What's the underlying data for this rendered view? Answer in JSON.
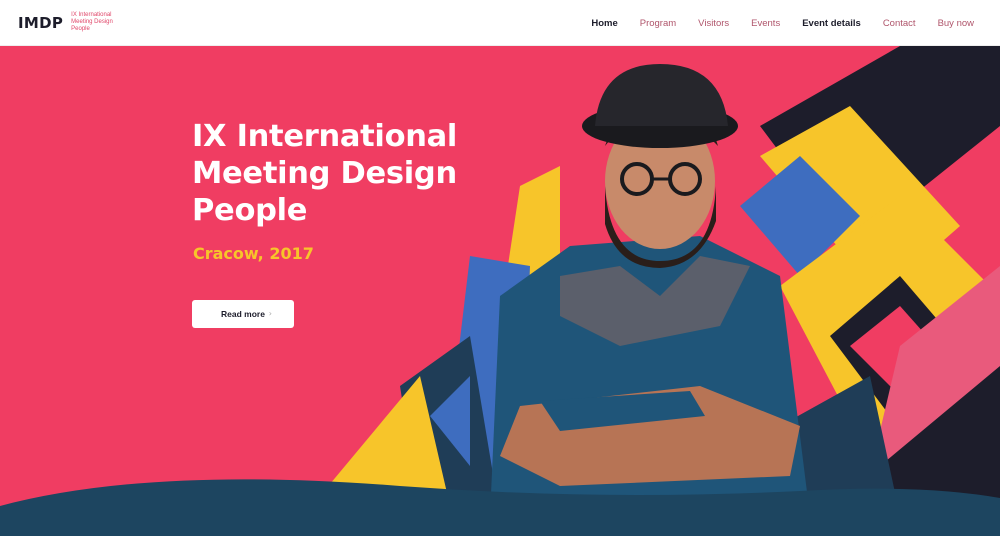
{
  "brand": {
    "logo": "IMDP",
    "tagline": "IX International Meeting Design People"
  },
  "nav": {
    "items": [
      {
        "label": "Home"
      },
      {
        "label": "Program"
      },
      {
        "label": "Visitors"
      },
      {
        "label": "Events"
      },
      {
        "label": "Event details"
      },
      {
        "label": "Contact"
      },
      {
        "label": "Buy now"
      }
    ]
  },
  "hero": {
    "title": "IX International Meeting Design People",
    "subtitle": "Cracow, 2017",
    "cta_label": "Read more",
    "cta_arrow": "›",
    "image_icon": "portrait-man-icon"
  },
  "colors": {
    "background": "#f03d62",
    "accent_yellow": "#f7c52a",
    "blue": "#3e6dbf",
    "navy": "#1f3d57",
    "dark": "#1d1d2b"
  }
}
